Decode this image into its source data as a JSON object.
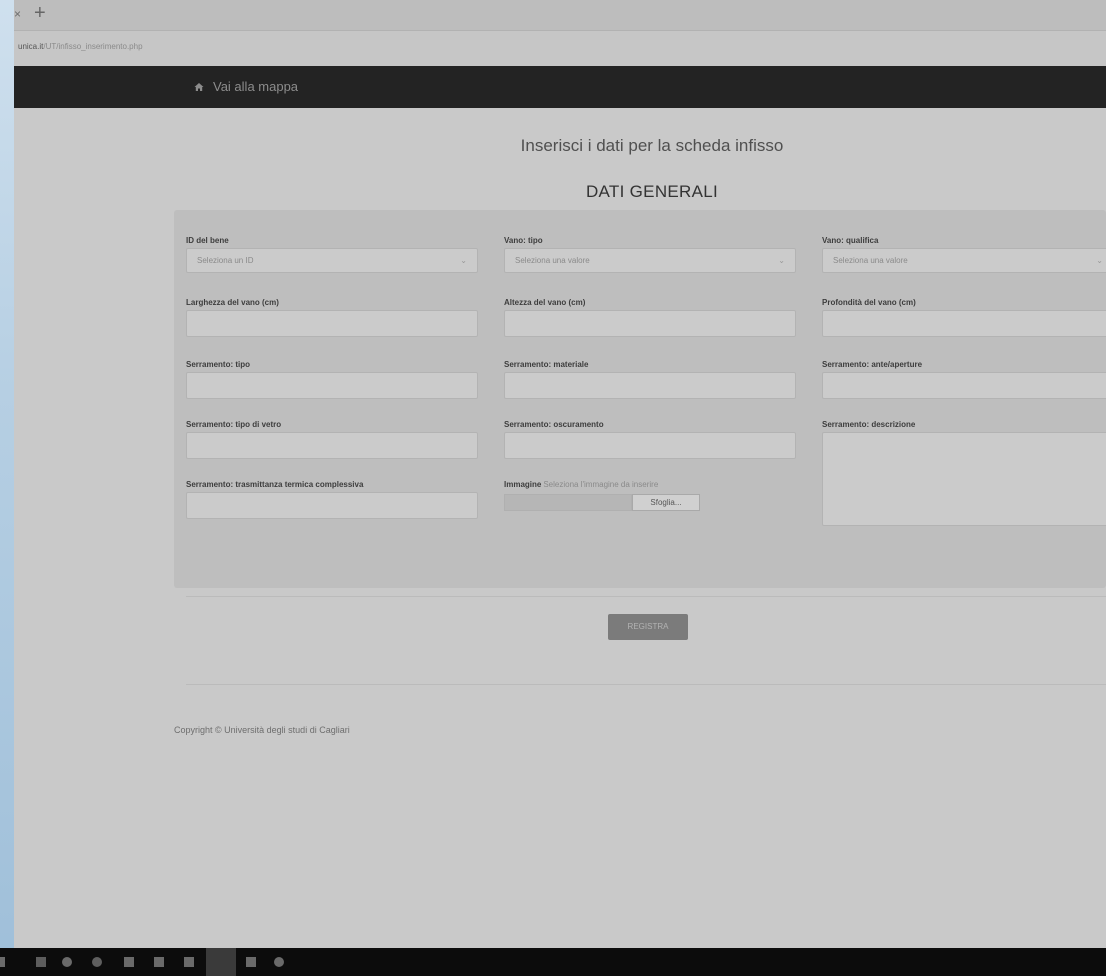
{
  "browser": {
    "tab_close": "×",
    "new_tab": "+",
    "url_host": "unica.it",
    "url_path": "/UT/infisso_inserimento.php"
  },
  "navbar": {
    "home_label": "Vai alla mappa",
    "home_icon": "home-icon"
  },
  "page": {
    "title": "Inserisci i dati per la scheda infisso",
    "section": "DATI GENERALI"
  },
  "form": {
    "id_bene": {
      "label": "ID del bene",
      "placeholder": "Seleziona un ID"
    },
    "vano_tipo": {
      "label": "Vano: tipo",
      "placeholder": "Seleziona una valore"
    },
    "vano_qualifica": {
      "label": "Vano: qualifica",
      "placeholder": "Seleziona una valore"
    },
    "larghezza": {
      "label": "Larghezza del vano (cm)"
    },
    "altezza": {
      "label": "Altezza del vano (cm)"
    },
    "profondita": {
      "label": "Profondità del vano (cm)"
    },
    "serr_tipo": {
      "label": "Serramento: tipo"
    },
    "serr_materiale": {
      "label": "Serramento: materiale"
    },
    "serr_ante": {
      "label": "Serramento: ante/aperture"
    },
    "serr_vetro": {
      "label": "Serramento: tipo di vetro"
    },
    "serr_oscuramento": {
      "label": "Serramento: oscuramento"
    },
    "serr_descrizione": {
      "label": "Serramento: descrizione"
    },
    "serr_trasmittanza": {
      "label": "Serramento: trasmittanza termica complessiva"
    },
    "immagine": {
      "label": "Immagine",
      "note": "Seleziona l'immagine da inserire",
      "browse_label": "Sfoglia..."
    },
    "submit_label": "REGISTRA"
  },
  "footer": {
    "copyright": "Copyright © Università degli studi di Cagliari"
  },
  "colors": {
    "navbar": "#232323",
    "page_bg": "#c9c9c9",
    "panel_bg": "#bebebe",
    "button_bg": "#7b7b7b"
  }
}
